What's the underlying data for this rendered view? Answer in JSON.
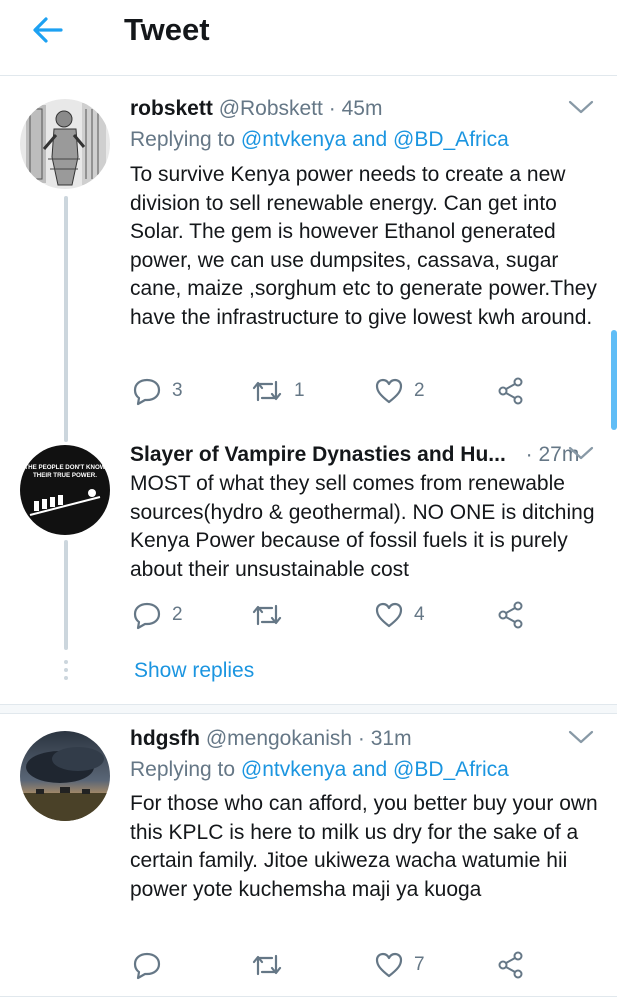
{
  "header": {
    "title": "Tweet"
  },
  "tweets": [
    {
      "name": "robskett",
      "handle": "@Robskett",
      "sep": "·",
      "time": "45m",
      "replying_prefix": "Replying to",
      "replying_to_1": "@ntvkenya",
      "replying_and": "and",
      "replying_to_2": "@BD_Africa",
      "text": "To survive Kenya power needs to create a new division to sell renewable energy. Can get into Solar. The gem is however Ethanol generated power, we can use dumpsites, cassava, sugar cane, maize ,sorghum etc to generate power.They have the infrastructure to give lowest kwh around.",
      "replies": "3",
      "retweets": "1",
      "likes": "2",
      "avatar_icon": "sketch-portrait-avatar"
    },
    {
      "name": "Slayer of Vampire Dynasties and Hu...",
      "sep": "·",
      "time": "27m",
      "text": "MOST of what they sell comes from renewable sources(hydro & geothermal). NO ONE is ditching Kenya Power because of fossil fuels it is purely about their unsustainable cost",
      "replies": "2",
      "retweets": "",
      "likes": "4",
      "avatar_text": "THE PEOPLE DON'T KNOW THEIR TRUE POWER."
    },
    {
      "name": "hdgsfh",
      "handle": "@mengokanish",
      "sep": "·",
      "time": "31m",
      "replying_prefix": "Replying to",
      "replying_to_1": "@ntvkenya",
      "replying_and": "and",
      "replying_to_2": "@BD_Africa",
      "text": "For those who can afford, you better buy your own this KPLC is here to milk us dry for the sake of a certain family. Jitoe ukiweza wacha watumie hii power yote kuchemsha maji ya kuoga",
      "replies": "",
      "retweets": "",
      "likes": "7",
      "avatar_icon": "stormy-landscape-avatar"
    }
  ],
  "show_replies": "Show replies",
  "colors": {
    "accent": "#1b95e0",
    "muted": "#657786",
    "text": "#14171a",
    "divider": "#e1e8ed"
  }
}
